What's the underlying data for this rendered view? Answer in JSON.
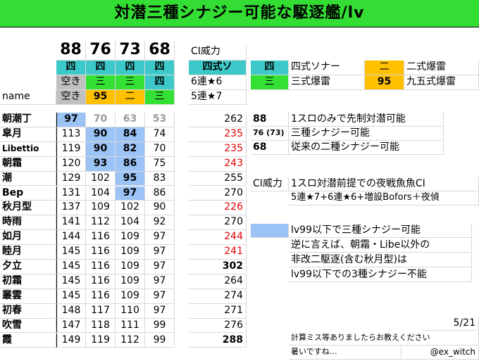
{
  "title": "対潜三種シナジー可能な駆逐艦/lv",
  "header": {
    "lv_cols": [
      "88",
      "76",
      "73",
      "68"
    ],
    "ci_label": "CI威力",
    "row1": [
      "四",
      "四",
      "四",
      "四",
      "四式ソ"
    ],
    "row2": [
      "空き",
      "三",
      "三",
      "四",
      "6連★6"
    ],
    "row3": [
      "空き",
      "95",
      "二",
      "三",
      "5連★7"
    ],
    "name_label": "name"
  },
  "legend": {
    "k1": "四",
    "v1": "四式ソナー",
    "k2": "二",
    "v2": "二式爆雷",
    "k3": "三",
    "v3": "三式爆雷",
    "k4": "95",
    "v4": "九五式爆雷"
  },
  "ships": [
    {
      "name": "朝潮丁",
      "c88": "97",
      "c76": "70",
      "c73": "63",
      "c68": "53",
      "ci": "262"
    },
    {
      "name": "皐月",
      "c88": "113",
      "c76": "90",
      "c73": "84",
      "c68": "74",
      "ci": "235"
    },
    {
      "name": "Libettio",
      "c88": "119",
      "c76": "90",
      "c73": "82",
      "c68": "70",
      "ci": "235"
    },
    {
      "name": "朝霜",
      "c88": "120",
      "c76": "93",
      "c73": "86",
      "c68": "75",
      "ci": "243"
    },
    {
      "name": "潮",
      "c88": "129",
      "c76": "102",
      "c73": "95",
      "c68": "83",
      "ci": "255"
    },
    {
      "name": "Bep",
      "c88": "131",
      "c76": "104",
      "c73": "97",
      "c68": "86",
      "ci": "270"
    },
    {
      "name": "秋月型",
      "c88": "137",
      "c76": "109",
      "c73": "102",
      "c68": "90",
      "ci": "226"
    },
    {
      "name": "時雨",
      "c88": "141",
      "c76": "112",
      "c73": "104",
      "c68": "92",
      "ci": "270"
    },
    {
      "name": "如月",
      "c88": "144",
      "c76": "116",
      "c73": "109",
      "c68": "97",
      "ci": "244"
    },
    {
      "name": "睦月",
      "c88": "145",
      "c76": "116",
      "c73": "109",
      "c68": "97",
      "ci": "241"
    },
    {
      "name": "夕立",
      "c88": "145",
      "c76": "116",
      "c73": "109",
      "c68": "97",
      "ci": "302"
    },
    {
      "name": "初霜",
      "c88": "145",
      "c76": "116",
      "c73": "109",
      "c68": "97",
      "ci": "264"
    },
    {
      "name": "叢雲",
      "c88": "145",
      "c76": "116",
      "c73": "109",
      "c68": "97",
      "ci": "274"
    },
    {
      "name": "初春",
      "c88": "148",
      "c76": "117",
      "c73": "110",
      "c68": "97",
      "ci": "271"
    },
    {
      "name": "吹雪",
      "c88": "147",
      "c76": "118",
      "c73": "111",
      "c68": "99",
      "ci": "276"
    },
    {
      "name": "霞",
      "c88": "149",
      "c76": "119",
      "c73": "112",
      "c68": "99",
      "ci": "288"
    }
  ],
  "notes": {
    "k88": "88",
    "n88": "1スロのみで先制対潜可能",
    "k76": "76 (73)",
    "n76": "三種シナジー可能",
    "k68": "68",
    "n68": "従来の二種シナジー可能",
    "kci": "CI威力",
    "nci": "1スロ対潜前提での夜戦魚魚CI",
    "nci2": "5連★7+6連★6+増設Bofors＋夜偵",
    "nblue": "lv99以下で三種シナジー可能",
    "p1": "逆に言えば、朝霜・Libe以外の",
    "p2": "非改二駆逐(含む秋月型)は",
    "p3": "lv99以下での3種シナジー不能",
    "date": "5/21",
    "f1": "計算ミス等ありましたらお教えください",
    "f2": "暑いですね…",
    "handle": "@ex_witch"
  }
}
